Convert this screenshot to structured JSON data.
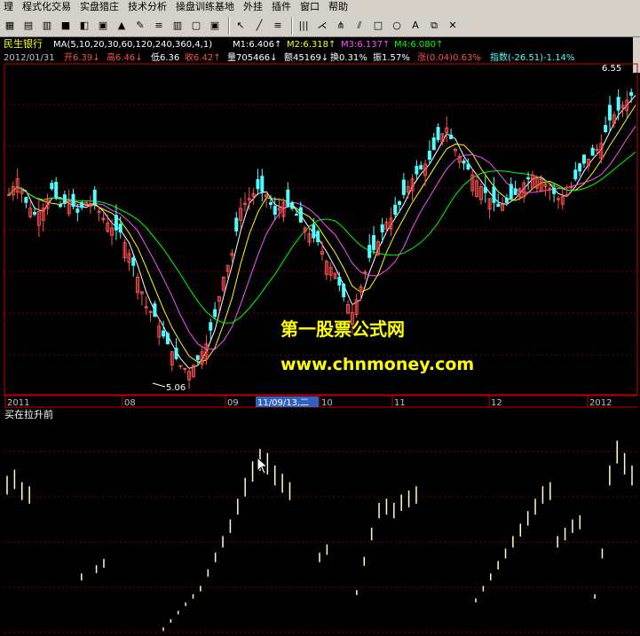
{
  "menu": [
    "理",
    "程式化交易",
    "实盘猎庄",
    "技术分析",
    "操盘训练基地",
    "外挂",
    "插件",
    "窗口",
    "帮助"
  ],
  "toolbar": {
    "icons": [
      "chart-icon",
      "table-icon",
      "grid-icon",
      "book-icon",
      "cube-icon",
      "disk-icon",
      "alert-icon",
      "pen-icon",
      "list-icon",
      "bars-icon",
      "page-icon",
      "monitor-icon",
      "sep",
      "cursor-icon",
      "line-icon",
      "textline-icon",
      "sep",
      "vbars-icon",
      "fan-icon",
      "fork-icon",
      "parallel-icon",
      "rect-icon",
      "ellipse-icon",
      "text-tool-icon",
      "copy-icon",
      "delete-icon"
    ],
    "glyphs": [
      "▦",
      "▤",
      "▥",
      "■",
      "◧",
      "▣",
      "▲",
      "✎",
      "≡",
      "▥",
      "▢",
      "▣",
      "",
      "↖",
      "╱",
      "≡",
      "",
      "|||",
      "⋌",
      "⋔",
      "⫽",
      "□",
      "○",
      "A",
      "⧉",
      "✕"
    ]
  },
  "header": {
    "stock_name": "民生银行",
    "ma_label": "MA(5,10,20,30,60,120,240,360,4,1)",
    "m1": "M1:6.406↑",
    "m2": "M2:6.318↑",
    "m3": "M3:6.137↑",
    "m4": "M4:6.080↑"
  },
  "info": {
    "date": "2012/01/31",
    "open": "开6.39↓",
    "high": "高6.46↓",
    "low": "低6.36",
    "close": "收6.42↑",
    "volume": "量705466↓",
    "amount": "额45169↓",
    "turnover": "换0.31%",
    "amplitude": "振1.57%",
    "change": "涨(0.04)0.63%",
    "index": "指数(-26.51)-1.14%"
  },
  "price_labels": {
    "high": "6.55",
    "low": "5.06"
  },
  "time_axis": [
    "2011",
    "08",
    "09",
    "10",
    "11",
    "12",
    "2012"
  ],
  "crosshair_label": "11/09/13,二",
  "watermark": {
    "title": "第一股票公式网",
    "url": "www.chnmoney.com"
  },
  "subchart_title": "买在拉升前",
  "colors": {
    "up": "#ff5050",
    "down": "#50ffff",
    "ma1": "#ffffff",
    "ma2": "#ffff00",
    "ma3": "#ff50ff",
    "ma4": "#00ff00",
    "grid": "#800000",
    "axis": "#c00000"
  },
  "chart_data": [
    {
      "type": "candlestick",
      "title": "民生银行",
      "y_range": [
        5.06,
        6.55
      ],
      "series": [
        {
          "name": "M1",
          "value": 6.406
        },
        {
          "name": "M2",
          "value": 6.318
        },
        {
          "name": "M3",
          "value": 6.137
        },
        {
          "name": "M4",
          "value": 6.08
        }
      ],
      "close_path": [
        6.02,
        6.1,
        5.98,
        5.92,
        5.95,
        6.05,
        5.96,
        5.99,
        5.93,
        5.98,
        5.97,
        5.9,
        5.85,
        5.83,
        5.72,
        5.6,
        5.45,
        5.4,
        5.3,
        5.22,
        5.15,
        5.12,
        5.18,
        5.26,
        5.4,
        5.6,
        5.72,
        5.95,
        6.0,
        6.05,
        6.02,
        5.92,
        5.98,
        5.95,
        5.88,
        5.82,
        5.78,
        5.68,
        5.62,
        5.5,
        5.42,
        5.55,
        5.7,
        5.78,
        5.88,
        5.92,
        6.02,
        6.1,
        6.15,
        6.2,
        6.3,
        6.36,
        6.25,
        6.18,
        6.12,
        6.06,
        6.0,
        5.96,
        5.98,
        6.02,
        6.08,
        6.12,
        6.1,
        6.05,
        6.0,
        6.02,
        6.1,
        6.18,
        6.22,
        6.28,
        6.4,
        6.45,
        6.5,
        6.55
      ]
    },
    {
      "type": "bar",
      "title": "买在拉升前",
      "values": [
        0.75,
        0.78,
        0.72,
        0.7,
        0,
        0,
        0,
        0,
        0,
        0,
        0.28,
        0,
        0.32,
        0.35,
        0,
        0,
        0,
        0,
        0,
        0,
        0,
        0.02,
        0.06,
        0.1,
        0.14,
        0.18,
        0.22,
        0.3,
        0.38,
        0.46,
        0.54,
        0.64,
        0.74,
        0.82,
        0.88,
        0.86,
        0.8,
        0.76,
        0.72,
        0,
        0,
        0,
        0.38,
        0.42,
        0,
        0,
        0,
        0.2,
        0.36,
        0.5,
        0.62,
        0.64,
        0.62,
        0.66,
        0.68,
        0.7,
        0,
        0,
        0,
        0,
        0,
        0,
        0,
        0.16,
        0.22,
        0.28,
        0.34,
        0.4,
        0.46,
        0.52,
        0.58,
        0.64,
        0.7,
        0.72,
        0.46,
        0.5,
        0.54,
        0.56,
        0,
        0.18,
        0.4,
        0.8,
        0.92,
        0.86,
        0.8
      ]
    }
  ]
}
